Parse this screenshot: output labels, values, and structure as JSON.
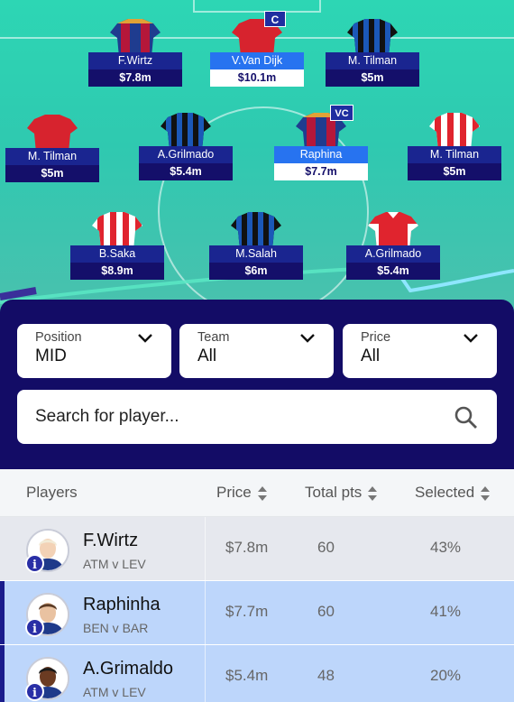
{
  "pitch": {
    "players": [
      {
        "name": "F.Wirtz",
        "price": "$7.8m",
        "kit": "barca",
        "selected": false
      },
      {
        "name": "V.Van Dijk",
        "price": "$10.1m",
        "kit": "red",
        "selected": true,
        "badge": "C"
      },
      {
        "name": "M. Tilman",
        "price": "$5m",
        "kit": "inter",
        "selected": false
      },
      {
        "name": "M. Tilman",
        "price": "$5m",
        "kit": "red",
        "selected": false
      },
      {
        "name": "A.Grilmado",
        "price": "$5.4m",
        "kit": "inter",
        "selected": false
      },
      {
        "name": "Raphina",
        "price": "$7.7m",
        "kit": "barca",
        "selected": true,
        "badge": "VC"
      },
      {
        "name": "M. Tilman",
        "price": "$5m",
        "kit": "stripes",
        "selected": false
      },
      {
        "name": "B.Saka",
        "price": "$8.9m",
        "kit": "stripes",
        "selected": false
      },
      {
        "name": "M.Salah",
        "price": "$6m",
        "kit": "inter",
        "selected": false
      },
      {
        "name": "A.Grilmado",
        "price": "$5.4m",
        "kit": "arsenal",
        "selected": false
      }
    ]
  },
  "filters": [
    {
      "label": "Position",
      "value": "MID"
    },
    {
      "label": "Team",
      "value": "All"
    },
    {
      "label": "Price",
      "value": "All"
    }
  ],
  "search": {
    "placeholder": "Search for player..."
  },
  "table": {
    "headers": {
      "players": "Players",
      "price": "Price",
      "points": "Total pts",
      "selected": "Selected"
    },
    "rows": [
      {
        "name": "F.Wirtz",
        "match": "ATM v LEV",
        "price": "$7.8m",
        "points": "60",
        "selected": "43%",
        "highlighted": false
      },
      {
        "name": "Raphinha",
        "match": "BEN v BAR",
        "price": "$7.7m",
        "points": "60",
        "selected": "41%",
        "highlighted": true
      },
      {
        "name": "A.Grimaldo",
        "match": "ATM v LEV",
        "price": "$5.4m",
        "points": "48",
        "selected": "20%",
        "highlighted": true
      }
    ]
  },
  "colors": {
    "navy": "#130c66",
    "accent": "#2773f0",
    "pitch": "#2dd6b4",
    "highlight": "#bdd6fb",
    "rowGrey": "#e6e8ee"
  }
}
